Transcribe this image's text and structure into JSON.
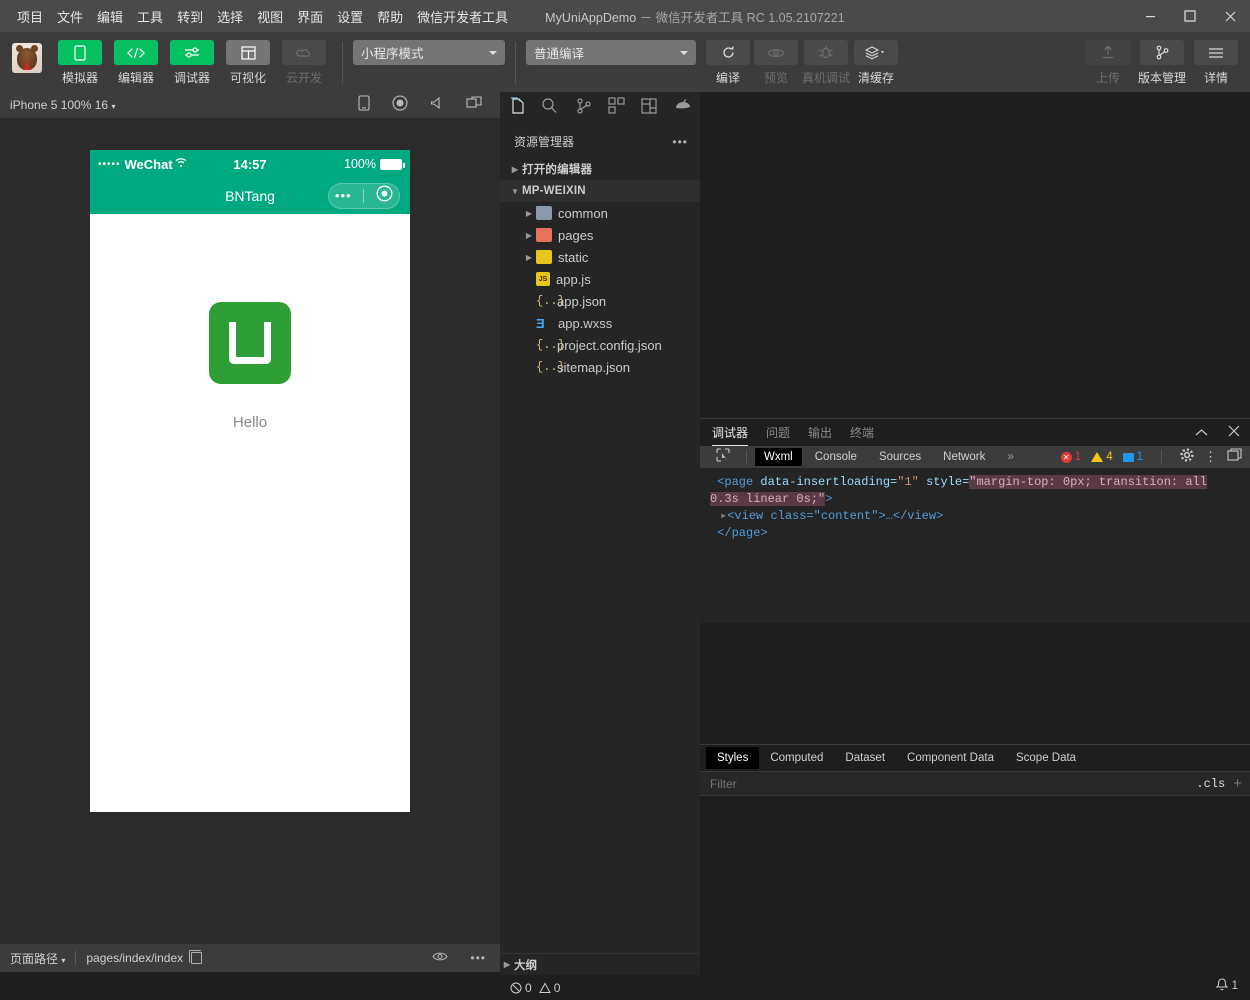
{
  "titlebar": {
    "menus": [
      "项目",
      "文件",
      "编辑",
      "工具",
      "转到",
      "选择",
      "视图",
      "界面",
      "设置",
      "帮助",
      "微信开发者工具"
    ],
    "project_name": "MyUniAppDemo",
    "separator": "－",
    "app_name": "微信开发者工具",
    "version": "RC 1.05.2107221",
    "controls": {
      "minimize": "minimize-icon",
      "maximize": "maximize-icon",
      "close": "close-icon"
    }
  },
  "toolbar": {
    "avatar": "user-avatar",
    "buttons": [
      {
        "label": "模拟器",
        "icon": "phone-icon",
        "state": "green"
      },
      {
        "label": "编辑器",
        "icon": "code-icon",
        "state": "green"
      },
      {
        "label": "调试器",
        "icon": "sliders-icon",
        "state": "green"
      },
      {
        "label": "可视化",
        "icon": "layout-icon",
        "state": "grey"
      },
      {
        "label": "云开发",
        "icon": "cloud-icon",
        "state": "disabled"
      }
    ],
    "mode_select": {
      "value": "小程序模式",
      "icon": "chevron-down-icon"
    },
    "compile_select": {
      "value": "普通编译",
      "icon": "chevron-down-icon"
    },
    "actions": [
      {
        "label": "编译",
        "icon": "refresh-icon",
        "state": "enabled"
      },
      {
        "label": "预览",
        "icon": "eye-icon",
        "state": "disabled"
      },
      {
        "label": "真机调试",
        "icon": "bug-icon",
        "state": "disabled"
      },
      {
        "label": "清缓存",
        "icon": "layers-icon",
        "state": "enabled"
      }
    ],
    "right_actions": [
      {
        "label": "上传",
        "icon": "upload-icon",
        "state": "disabled"
      },
      {
        "label": "版本管理",
        "icon": "git-branch-icon",
        "state": "enabled"
      },
      {
        "label": "详情",
        "icon": "menu-icon",
        "state": "enabled"
      }
    ]
  },
  "simulator": {
    "device_label": "iPhone 5 100% 16",
    "bar_icons": [
      "phone-rotate-icon",
      "record-icon",
      "volume-icon",
      "screenshot-icon"
    ],
    "status": {
      "carrier_dots": "•••••",
      "carrier": "WeChat",
      "wifi": "wifi-icon",
      "time": "14:57",
      "battery_percent": "100%"
    },
    "nav_title": "BNTang",
    "capsule": {
      "more": "•••",
      "close": "target-icon"
    },
    "page": {
      "logo": "uniapp-logo",
      "text": "Hello"
    }
  },
  "statusbar": {
    "route_label": "页面路径",
    "route_value": "pages/index/index",
    "copy_icon": "copy-icon",
    "eye_icon": "eye-icon",
    "more_icon": "more-icon"
  },
  "explorer": {
    "activity_icons": [
      "files-icon",
      "search-icon",
      "source-control-icon",
      "extensions-icon",
      "layout-icon",
      "debug-icon"
    ],
    "title": "资源管理器",
    "more_icon": "more-icon",
    "open_editors": "打开的编辑器",
    "project_root": "MP-WEIXIN",
    "items": [
      {
        "name": "common",
        "type": "folder",
        "color": "#8a99a8"
      },
      {
        "name": "pages",
        "type": "folder",
        "color": "#e8715c"
      },
      {
        "name": "static",
        "type": "folder",
        "color": "#e8c51c"
      },
      {
        "name": "app.js",
        "type": "js"
      },
      {
        "name": "app.json",
        "type": "json"
      },
      {
        "name": "app.wxss",
        "type": "css"
      },
      {
        "name": "project.config.json",
        "type": "json"
      },
      {
        "name": "sitemap.json",
        "type": "json"
      }
    ],
    "outline": "大纲",
    "problems": {
      "errors": "0",
      "warnings": "0"
    }
  },
  "debugger": {
    "tabs": [
      "调试器",
      "问题",
      "输出",
      "终端"
    ],
    "active_tab": "调试器",
    "collapse_icon": "chevron-up-icon",
    "close_icon": "close-icon",
    "devtools": {
      "inspect_icon": "inspect-icon",
      "tabs": [
        "Wxml",
        "Console",
        "Sources",
        "Network"
      ],
      "active_tab": "Wxml",
      "overflow": "»",
      "counts": {
        "errors": "1",
        "warnings": "4",
        "info": "1"
      },
      "settings_icon": "gear-icon",
      "kebab_icon": "more-vertical-icon",
      "dock_icon": "dock-icon"
    },
    "wxml": {
      "line1_tag": "<page",
      "line1_attr1": "data-insertloading=",
      "line1_val1": "\"1\"",
      "line1_attr2": "style=",
      "line1_val2_hl": "\"margin-top: 0px; transition: all 0.3s linear 0s;\"",
      "line1_end": ">",
      "line2": "<view class=\"content\">…</view>",
      "line3": "</page>"
    },
    "styles": {
      "tabs": [
        "Styles",
        "Computed",
        "Dataset",
        "Component Data",
        "Scope Data"
      ],
      "active_tab": "Styles",
      "filter_placeholder": "Filter",
      "cls_button": ".cls",
      "add_button": "+"
    }
  },
  "notification": {
    "icon": "bell-icon",
    "count": "1"
  },
  "colors": {
    "accent_green": "#07c160",
    "wechat_teal": "#00a97f",
    "logo_green": "#2f9e36",
    "titlebar": "#4a4a4a",
    "toolbar": "#3c3c3c",
    "editor_bg": "#1e1e1e",
    "sidebar_bg": "#252526"
  }
}
